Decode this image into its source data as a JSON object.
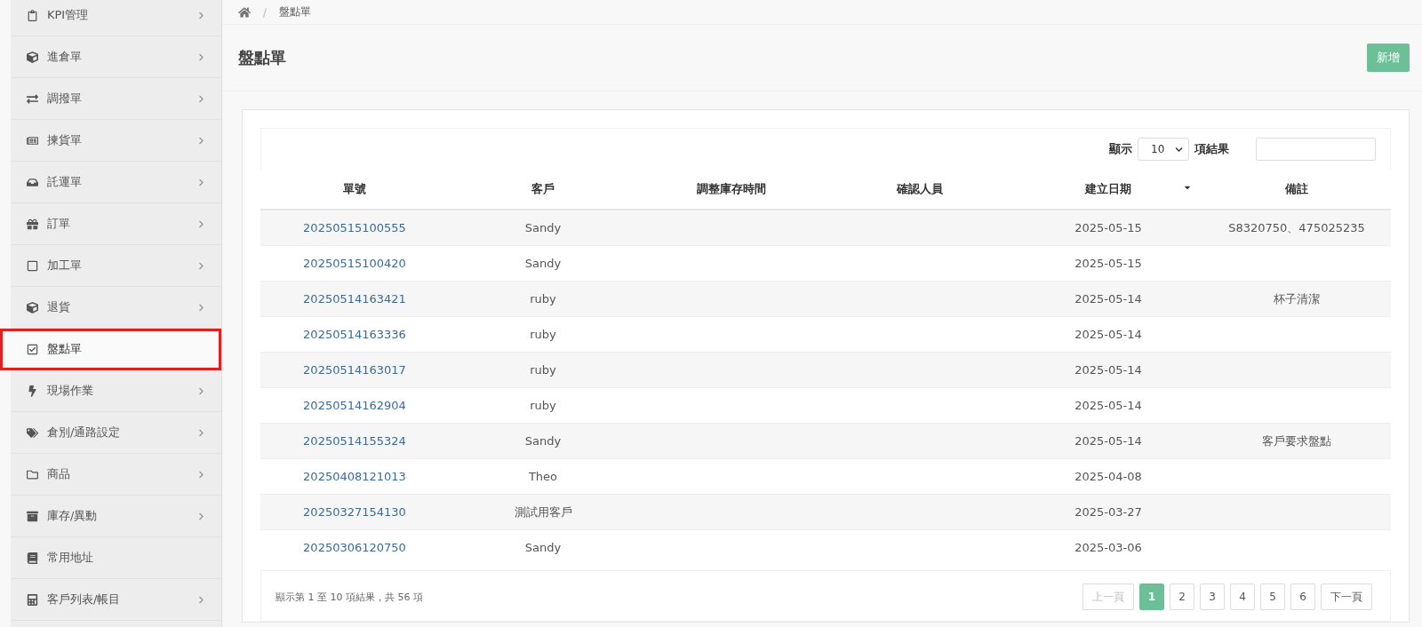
{
  "sidebar": {
    "items": [
      {
        "label": "KPI管理",
        "expandable": true,
        "selected": false
      },
      {
        "label": "進倉單",
        "expandable": true,
        "selected": false
      },
      {
        "label": "調撥單",
        "expandable": true,
        "selected": false
      },
      {
        "label": "揀貨單",
        "expandable": true,
        "selected": false
      },
      {
        "label": "託運單",
        "expandable": true,
        "selected": false
      },
      {
        "label": "訂單",
        "expandable": true,
        "selected": false
      },
      {
        "label": "加工單",
        "expandable": true,
        "selected": false
      },
      {
        "label": "退貨",
        "expandable": true,
        "selected": false
      },
      {
        "label": "盤點單",
        "expandable": false,
        "selected": true
      },
      {
        "label": "現場作業",
        "expandable": true,
        "selected": false
      },
      {
        "label": "倉別/通路設定",
        "expandable": true,
        "selected": false
      },
      {
        "label": "商品",
        "expandable": true,
        "selected": false
      },
      {
        "label": "庫存/異動",
        "expandable": true,
        "selected": false
      },
      {
        "label": "常用地址",
        "expandable": false,
        "selected": false
      },
      {
        "label": "客戶列表/帳目",
        "expandable": true,
        "selected": false
      }
    ]
  },
  "breadcrumb": {
    "separator": "/",
    "items": [
      "盤點單"
    ]
  },
  "page_title": "盤點單",
  "add_button": "新增",
  "length_control": {
    "prefix": "顯示",
    "value": "10",
    "suffix": "項結果"
  },
  "table": {
    "columns": [
      {
        "label": "單號",
        "sorted": false
      },
      {
        "label": "客戶",
        "sorted": false
      },
      {
        "label": "調整庫存時間",
        "sorted": false
      },
      {
        "label": "確認人員",
        "sorted": false
      },
      {
        "label": "建立日期",
        "sorted": true
      },
      {
        "label": "備註",
        "sorted": false
      }
    ],
    "rows": [
      [
        "20250515100555",
        "Sandy",
        "",
        "",
        "2025-05-15",
        "S8320750、475025235"
      ],
      [
        "20250515100420",
        "Sandy",
        "",
        "",
        "2025-05-15",
        ""
      ],
      [
        "20250514163421",
        "ruby",
        "",
        "",
        "2025-05-14",
        "杯子清潔"
      ],
      [
        "20250514163336",
        "ruby",
        "",
        "",
        "2025-05-14",
        ""
      ],
      [
        "20250514163017",
        "ruby",
        "",
        "",
        "2025-05-14",
        ""
      ],
      [
        "20250514162904",
        "ruby",
        "",
        "",
        "2025-05-14",
        ""
      ],
      [
        "20250514155324",
        "Sandy",
        "",
        "",
        "2025-05-14",
        "客戶要求盤點"
      ],
      [
        "20250408121013",
        "Theo",
        "",
        "",
        "2025-04-08",
        ""
      ],
      [
        "20250327154130",
        "測試用客戶",
        "",
        "",
        "2025-03-27",
        ""
      ],
      [
        "20250306120750",
        "Sandy",
        "",
        "",
        "2025-03-06",
        ""
      ]
    ]
  },
  "info": "顯示第 1 至 10 項結果，共 56 項",
  "pagination": [
    {
      "label": "上一頁",
      "kind": "nav",
      "disabled": true,
      "selected": false
    },
    {
      "label": "1",
      "kind": "page",
      "disabled": false,
      "selected": true
    },
    {
      "label": "2",
      "kind": "page",
      "disabled": false,
      "selected": false
    },
    {
      "label": "3",
      "kind": "page",
      "disabled": false,
      "selected": false
    },
    {
      "label": "4",
      "kind": "page",
      "disabled": false,
      "selected": false
    },
    {
      "label": "5",
      "kind": "page",
      "disabled": false,
      "selected": false
    },
    {
      "label": "6",
      "kind": "page",
      "disabled": false,
      "selected": false
    },
    {
      "label": "下一頁",
      "kind": "nav",
      "disabled": false,
      "selected": false
    }
  ]
}
